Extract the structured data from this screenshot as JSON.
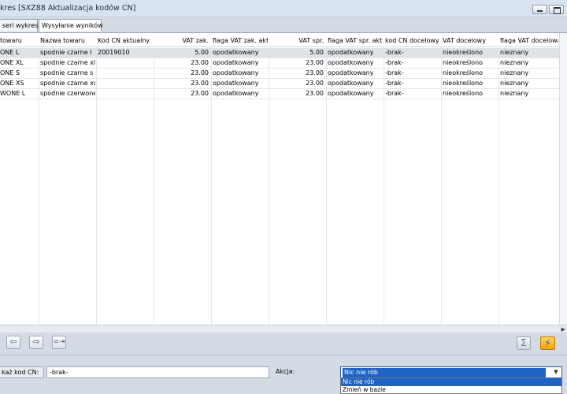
{
  "window": {
    "title": "kres [SXZ88 Aktualizacja kodów CN]"
  },
  "tabs": [
    "seri wykresu",
    "Wysyłanie wyników"
  ],
  "grid": {
    "columns": [
      "towaru",
      "Nazwa towaru",
      "Kod CN aktualny",
      "VAT zak.",
      "flaga VAT zak. aktu",
      "VAT spr.",
      "flaga VAT spr. aktu",
      "kod CN docelowy",
      "VAT docelowy",
      "flaga VAT docelowa"
    ],
    "rows": [
      [
        "ONE L",
        "spodnie czarne l",
        "20019010",
        "5.00",
        "opodatkowany",
        "5.00",
        "opodatkowany",
        "-brak-",
        "nieokreślono",
        "nieznany"
      ],
      [
        "ONE XL",
        "spodnie czarne xl",
        "",
        "23.00",
        "opodatkowany",
        "23.00",
        "opodatkowany",
        "-brak-",
        "nieokreślono",
        "nieznany"
      ],
      [
        "ONE S",
        "spodnie czarne s",
        "",
        "23.00",
        "opodatkowany",
        "23.00",
        "opodatkowany",
        "-brak-",
        "nieokreślono",
        "nieznany"
      ],
      [
        "ONE XS",
        "spodnie czarne xs",
        "",
        "23.00",
        "opodatkowany",
        "23.00",
        "opodatkowany",
        "-brak-",
        "nieokreślono",
        "nieznany"
      ],
      [
        "WONE L",
        "spodnie czerwone l",
        "",
        "23.00",
        "opodatkowany",
        "23.00",
        "opodatkowany",
        "-brak-",
        "nieokreślono",
        "nieznany"
      ]
    ]
  },
  "toolbar": {
    "prev_icon": "arrow-left-icon",
    "next_icon": "arrow-right-icon",
    "jump_icon": "jump-to-icon",
    "sum_icon": "sigma-icon",
    "run_icon": "lightning-icon"
  },
  "bottom": {
    "cn_button_label": "każ kod CN:",
    "cn_value": "-brak-",
    "akcja_label": "Akcja:",
    "akcja_selected": "Nic nie rób",
    "akcja_options": [
      "Nic nie rób",
      "Zmień w bazie"
    ]
  },
  "colors": {
    "selection": "#1f63c6",
    "run_button": "#f5a400",
    "selected_row": "#dfe3e8"
  }
}
